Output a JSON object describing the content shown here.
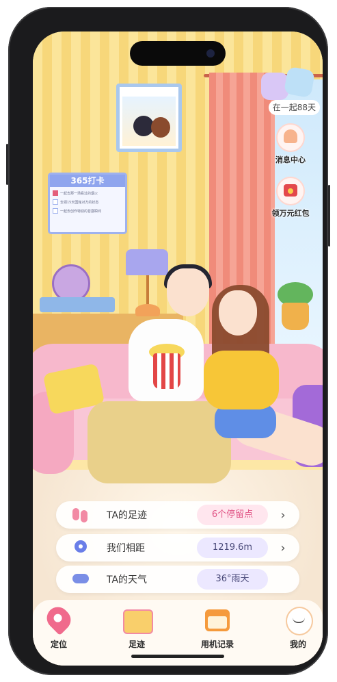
{
  "header": {
    "together_days": "在一起88天"
  },
  "side_actions": [
    {
      "label": "消息中心",
      "icon": "bell-icon"
    },
    {
      "label": "领万元红包",
      "icon": "red-envelope-icon"
    }
  ],
  "scene": {
    "checkin_board": {
      "title": "365打卡",
      "items": [
        "一起去那一场看过的烟火",
        "去領15天国館对方的状态",
        "一起去创作特别的苍露瞬间"
      ]
    }
  },
  "info_cards": [
    {
      "title": "TA的足迹",
      "value": "6个停留点",
      "icon": "footprints-icon"
    },
    {
      "title": "我们相距",
      "value": "1219.6m",
      "icon": "location-pin-icon"
    },
    {
      "title": "TA的天气",
      "value": "36°雨天",
      "icon": "rain-cloud-icon"
    }
  ],
  "tabs": [
    {
      "label": "定位",
      "icon": "location-icon"
    },
    {
      "label": "足迹",
      "icon": "map-icon"
    },
    {
      "label": "用机记录",
      "icon": "calendar-chart-icon"
    },
    {
      "label": "我的",
      "icon": "profile-icon"
    }
  ],
  "colors": {
    "accent_pink": "#e15586",
    "value_blue_bg": "#ece8ff",
    "wall_yellow": "#fbe59a"
  }
}
